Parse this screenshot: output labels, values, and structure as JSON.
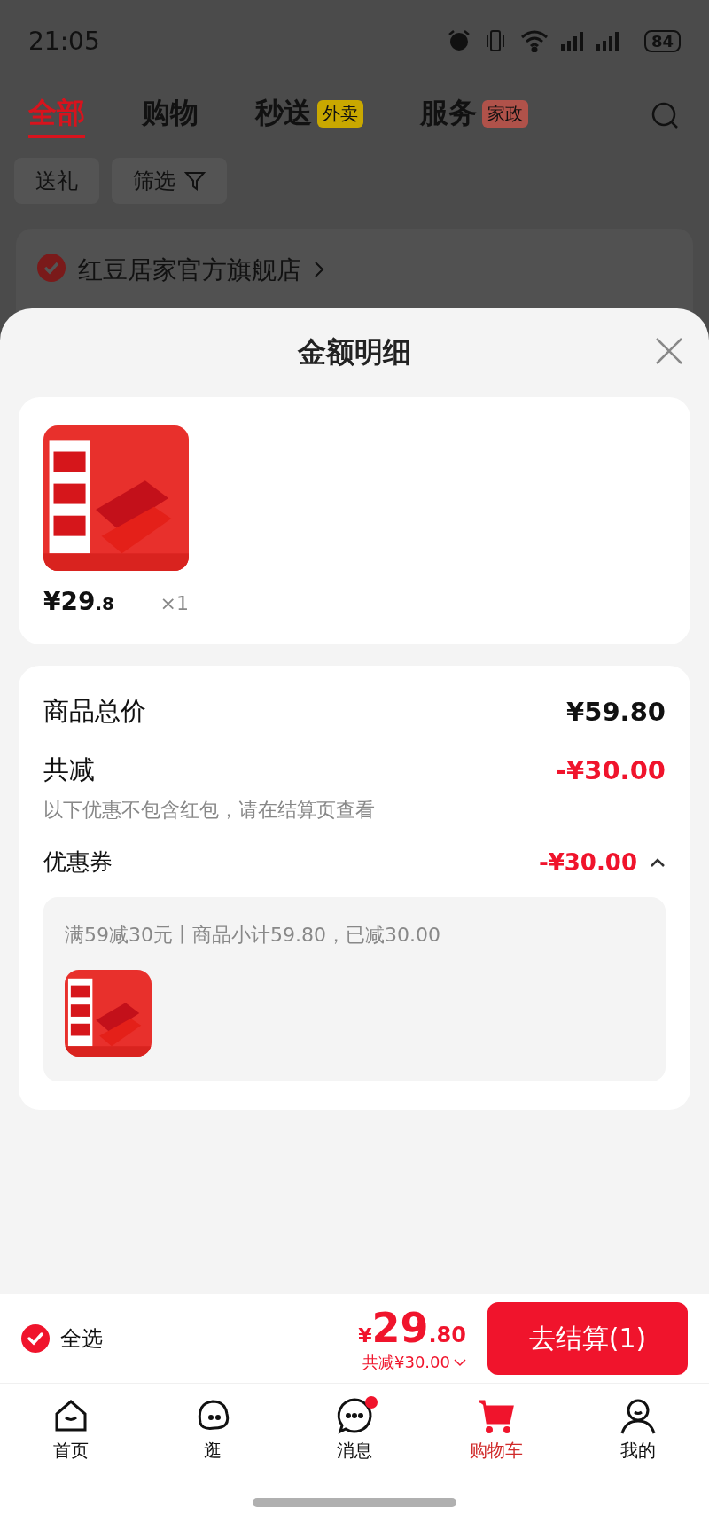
{
  "status_bar": {
    "time": "21:05",
    "battery": "84"
  },
  "tabs": [
    {
      "label": "全部",
      "selected": true
    },
    {
      "label": "购物",
      "selected": false
    },
    {
      "label": "秒送",
      "selected": false,
      "badge": "外卖",
      "color": "#c9a800"
    },
    {
      "label": "服务",
      "selected": false,
      "badge": "家政",
      "color": "#b0524a"
    }
  ],
  "chips": [
    {
      "label": "送礼",
      "kind": "plain"
    },
    {
      "label": "筛选",
      "kind": "filter"
    }
  ],
  "store": {
    "name": "红豆居家官方旗舰店",
    "checked": true
  },
  "sheet": {
    "title": "金额明细",
    "item": {
      "kind": "picture",
      "price_main": "¥29",
      "price_decimal": ".8",
      "quantity": "×1"
    },
    "summary": [
      {
        "label": "商品总价",
        "value": "¥59.80",
        "kind": "total"
      },
      {
        "label": "共减",
        "value": "-¥30.00",
        "kind": "discount",
        "note": "以下优惠不包含红包，请在结算页查看"
      },
      {
        "label": "优惠券",
        "value": "-¥30.00",
        "kind": "coupon",
        "expanded": true
      }
    ],
    "coupon_detail": {
      "text": "满59减30元丨商品小计59.80，已减30.00"
    }
  },
  "checkout": {
    "select_all": {
      "label": "全选",
      "checked": true
    },
    "currency": "¥",
    "price_main": "29",
    "price_decimal": ".80",
    "saved": "共减¥30.00",
    "button": "去结算(1)"
  },
  "nav": [
    {
      "label": "首页",
      "selected": false,
      "kind": "home"
    },
    {
      "label": "逛",
      "selected": false,
      "kind": "face"
    },
    {
      "label": "消息",
      "selected": false,
      "kind": "chat",
      "dot": true
    },
    {
      "label": "购物车",
      "selected": true,
      "kind": "cart"
    },
    {
      "label": "我的",
      "selected": false,
      "kind": "person"
    }
  ]
}
